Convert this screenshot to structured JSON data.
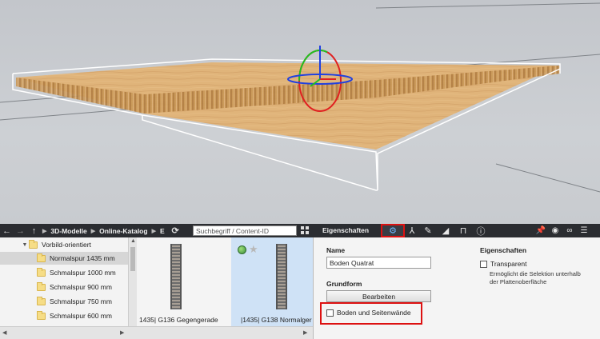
{
  "toolbar": {
    "breadcrumbs": [
      "3D-Modelle",
      "Online-Katalog",
      "E"
    ],
    "search_placeholder": "Suchbegriff / Content-ID",
    "properties_title": "Eigenschaften"
  },
  "tree": {
    "items": [
      {
        "label": "Vorbild-orientiert",
        "expanded": true
      },
      {
        "label": "Normalspur 1435 mm",
        "selected": true
      },
      {
        "label": "Schmalspur 1000 mm"
      },
      {
        "label": "Schmalspur 900 mm"
      },
      {
        "label": "Schmalspur 750 mm"
      },
      {
        "label": "Schmalspur 600 mm"
      }
    ]
  },
  "content": {
    "tiles": [
      {
        "label": "1435| G136 Gegengerade",
        "selected": false
      },
      {
        "label": "|1435| G138 Normalger",
        "selected": true
      }
    ]
  },
  "properties": {
    "name_label": "Name",
    "name_value": "Boden Quatrat",
    "grundform_label": "Grundform",
    "edit_button": "Bearbeiten",
    "floor_walls_checkbox": "Boden und Seitenwände",
    "eigenschaften_label": "Eigenschaften",
    "transparent_checkbox": "Transparent",
    "transparent_hint": "Ermöglicht die Selektion unterhalb der Plattenoberfläche"
  },
  "colors": {
    "toolbar_bg": "#2b2d31",
    "highlight": "#dd1111",
    "wood": "#d9a86a"
  }
}
